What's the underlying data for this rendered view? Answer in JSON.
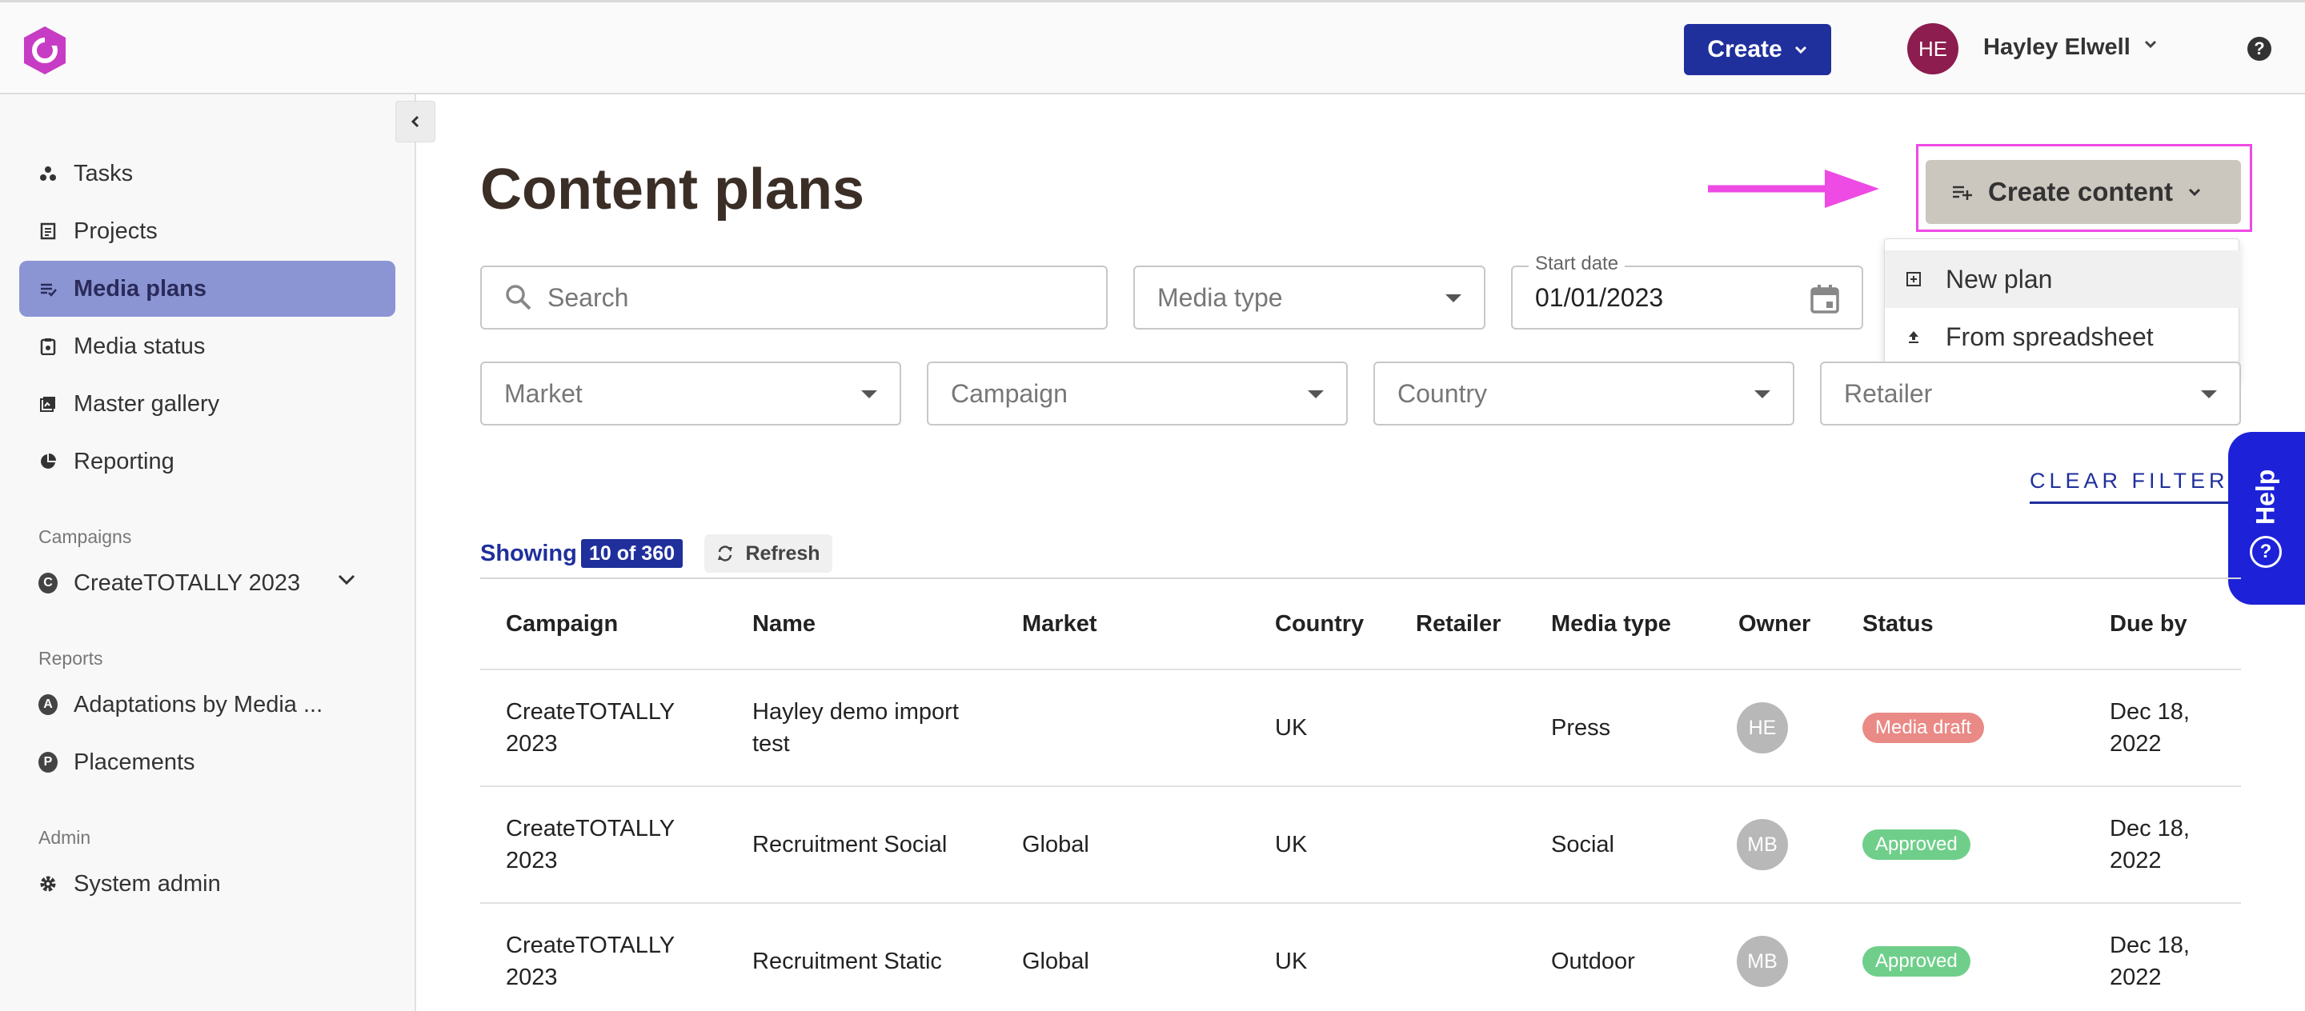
{
  "header": {
    "create_label": "Create",
    "user_initials": "HE",
    "user_name": "Hayley Elwell",
    "help_symbol": "?"
  },
  "sidebar": {
    "collapse_icon": "chevron-left-icon",
    "nav": [
      {
        "label": "Tasks",
        "icon": "tasks-icon"
      },
      {
        "label": "Projects",
        "icon": "projects-icon"
      },
      {
        "label": "Media plans",
        "icon": "media-plans-icon",
        "active": true
      },
      {
        "label": "Media status",
        "icon": "media-status-icon"
      },
      {
        "label": "Master gallery",
        "icon": "gallery-icon"
      },
      {
        "label": "Reporting",
        "icon": "pie-chart-icon"
      }
    ],
    "campaigns_label": "Campaigns",
    "campaign": {
      "letter": "C",
      "label": "CreateTOTALLY 2023"
    },
    "reports_label": "Reports",
    "reports": [
      {
        "letter": "A",
        "label": "Adaptations by Media ..."
      },
      {
        "letter": "P",
        "label": "Placements"
      }
    ],
    "admin_label": "Admin",
    "admin": {
      "label": "System admin",
      "icon": "gear-icon"
    }
  },
  "main": {
    "title": "Content plans",
    "create_content_label": "Create content",
    "dropdown": [
      {
        "label": "New plan",
        "icon": "plus-box-icon"
      },
      {
        "label": "From spreadsheet",
        "icon": "upload-icon"
      }
    ],
    "filters": {
      "search_placeholder": "Search",
      "media_type": "Media type",
      "start_date_label": "Start date",
      "start_date_value": "01/01/2023",
      "market": "Market",
      "campaign": "Campaign",
      "country": "Country",
      "retailer": "Retailer",
      "clear": "CLEAR FILTERS"
    },
    "help_tab": "Help",
    "showing_label": "Showing",
    "showing_count": "10 of 360",
    "refresh_label": "Refresh"
  },
  "table": {
    "headers": [
      "Campaign",
      "Name",
      "Market",
      "Country",
      "Retailer",
      "Media type",
      "Owner",
      "Status",
      "Due by"
    ],
    "rows": [
      {
        "campaign": [
          "CreateTOTALLY",
          "2023"
        ],
        "name": [
          "Hayley demo import",
          "test"
        ],
        "market": "",
        "country": "UK",
        "retailer": "",
        "media_type": "Press",
        "owner": "HE",
        "status": "Media draft",
        "due": [
          "Dec 18,",
          "2022"
        ]
      },
      {
        "campaign": [
          "CreateTOTALLY",
          "2023"
        ],
        "name": [
          "Recruitment Social"
        ],
        "market": "Global",
        "country": "UK",
        "retailer": "",
        "media_type": "Social",
        "owner": "MB",
        "status": "Approved",
        "due": [
          "Dec 18,",
          "2022"
        ]
      },
      {
        "campaign": [
          "CreateTOTALLY",
          "2023"
        ],
        "name": [
          "Recruitment Static"
        ],
        "market": "Global",
        "country": "UK",
        "retailer": "",
        "media_type": "Outdoor",
        "owner": "MB",
        "status": "Approved",
        "due": [
          "Dec 18,",
          "2022"
        ]
      }
    ]
  },
  "colors": {
    "brand_blue": "#1f2f9c",
    "active_nav": "#8b95d4",
    "highlight_magenta": "#ee4ae4",
    "status_draft": "#e98a86",
    "status_approved": "#6fcf8a",
    "logo": "#c63cc4"
  }
}
